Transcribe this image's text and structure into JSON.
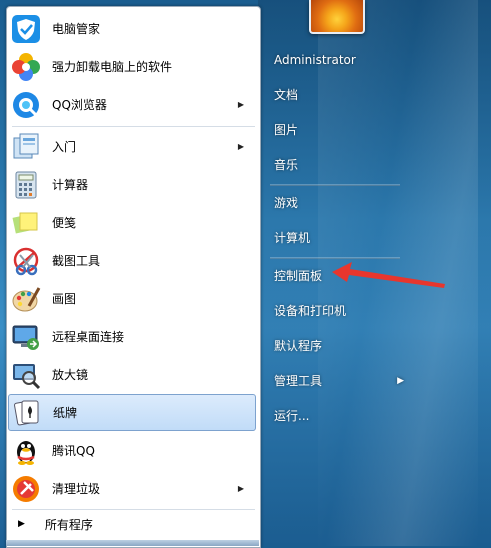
{
  "pinned": [
    {
      "label": "电脑管家",
      "icon": "shield-icon",
      "submenu": false
    },
    {
      "label": "强力卸载电脑上的软件",
      "icon": "clover-icon",
      "submenu": false
    },
    {
      "label": "QQ浏览器",
      "icon": "qq-browser-icon",
      "submenu": true
    }
  ],
  "recent": [
    {
      "label": "入门",
      "icon": "getting-started-icon",
      "submenu": true
    },
    {
      "label": "计算器",
      "icon": "calculator-icon",
      "submenu": false
    },
    {
      "label": "便笺",
      "icon": "sticky-notes-icon",
      "submenu": false
    },
    {
      "label": "截图工具",
      "icon": "snipping-tool-icon",
      "submenu": false
    },
    {
      "label": "画图",
      "icon": "paint-icon",
      "submenu": false
    },
    {
      "label": "远程桌面连接",
      "icon": "remote-desktop-icon",
      "submenu": false
    },
    {
      "label": "放大镜",
      "icon": "magnifier-icon",
      "submenu": false
    },
    {
      "label": "纸牌",
      "icon": "solitaire-icon",
      "submenu": false,
      "selected": true
    },
    {
      "label": "腾讯QQ",
      "icon": "qq-penguin-icon",
      "submenu": false
    },
    {
      "label": "清理垃圾",
      "icon": "cleanup-icon",
      "submenu": true
    }
  ],
  "all_programs": "所有程序",
  "right": {
    "user": "Administrator",
    "docs": "文档",
    "pictures": "图片",
    "music": "音乐",
    "games": "游戏",
    "computer": "计算机",
    "control_panel": "控制面板",
    "devices": "设备和打印机",
    "default_programs": "默认程序",
    "admin_tools": "管理工具",
    "run": "运行..."
  },
  "colors": {
    "selection": "#c1dcf8",
    "pointer": "#e8362d"
  }
}
